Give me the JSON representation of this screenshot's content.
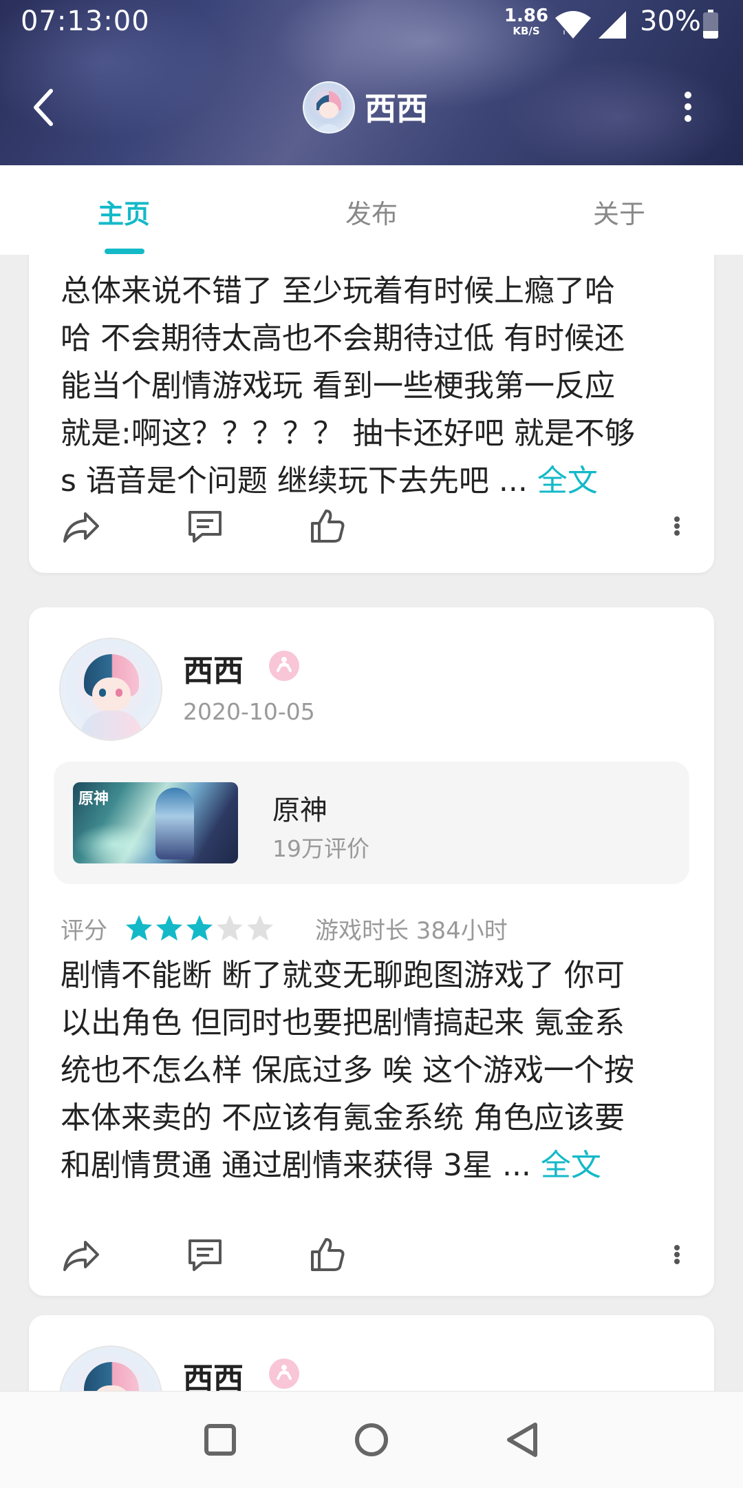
{
  "status_bar": {
    "time": "07:13:00",
    "net_speed_value": "1.86",
    "net_speed_unit": "KB/S",
    "battery_percent": "30%",
    "battery_level": 0.3,
    "icons": [
      "wifi-icon",
      "signal-icon",
      "battery-icon"
    ]
  },
  "header": {
    "title": "西西",
    "icons": [
      "back-arrow-icon",
      "more-vertical-icon"
    ]
  },
  "tabs": [
    {
      "label": "主页",
      "active": true
    },
    {
      "label": "发布",
      "active": false
    },
    {
      "label": "关于",
      "active": false
    }
  ],
  "posts": [
    {
      "text": "总体来说不错了 至少玩着有时候上瘾了哈哈 不会期待太高也不会期待过低 有时候还能当个剧情游戏玩 看到一些梗我第一反应就是:啊这？？？？？  抽卡还好吧 就是不够s 语音是个问题 继续玩下去先吧 ...",
      "lines": [
        "总体来说不错了 至少玩着有时候上瘾了哈",
        "哈 不会期待太高也不会期待过低 有时候还",
        "能当个剧情游戏玩 看到一些梗我第一反应",
        "就是:啊这？？？？？  抽卡还好吧 就是不够",
        "s 语音是个问题 继续玩下去先吧 ... "
      ],
      "more_label": "全文"
    },
    {
      "user_name": "西西",
      "date": "2020-10-05",
      "game": {
        "name": "原神",
        "reviews": "19万评价",
        "cover_logo": "原神"
      },
      "rating_label": "评分",
      "rating": 3,
      "rating_max": 5,
      "play_time": "游戏时长 384小时",
      "lines": [
        "剧情不能断 断了就变无聊跑图游戏了 你可",
        "以出角色 但同时也要把剧情搞起来 氪金系",
        "统也不怎么样 保底过多 唉 这个游戏一个按",
        "本体来卖的 不应该有氪金系统 角色应该要",
        "和剧情贯通 通过剧情来获得 3星 ... "
      ],
      "more_label": "全文"
    },
    {
      "user_name": "西西"
    }
  ],
  "actions": [
    "share-icon",
    "comment-icon",
    "like-icon",
    "more-vertical-icon"
  ],
  "colors": {
    "accent": "#14b9c8",
    "star_filled": "#14b9c8",
    "star_empty": "#e0e0e0",
    "badge": "#f48fb1"
  },
  "system_nav": [
    "square-recents-icon",
    "circle-home-icon",
    "triangle-back-icon"
  ]
}
